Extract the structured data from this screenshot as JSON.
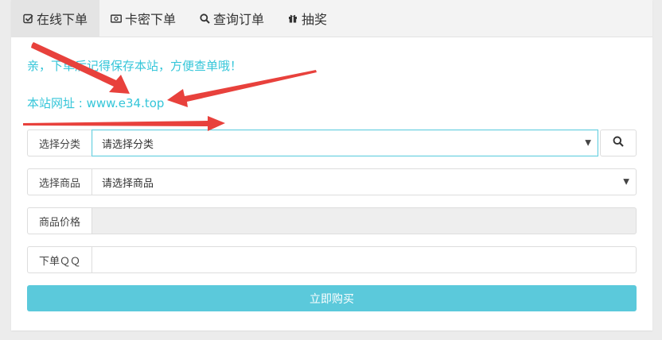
{
  "tabs": [
    {
      "label": "在线下单",
      "icon": "check-square-icon",
      "active": true
    },
    {
      "label": "卡密下单",
      "icon": "money-icon",
      "active": false
    },
    {
      "label": "查询订单",
      "icon": "search-icon",
      "active": false
    },
    {
      "label": "抽奖",
      "icon": "gift-icon",
      "active": false
    }
  ],
  "notice": {
    "line1": "亲，下单后记得保存本站，方便查单哦！",
    "line2": "本站网址 : www.e34.top"
  },
  "form": {
    "category": {
      "label": "选择分类",
      "value": "请选择分类"
    },
    "product": {
      "label": "选择商品",
      "value": "请选择商品"
    },
    "price": {
      "label": "商品价格",
      "value": ""
    },
    "qq": {
      "label": "下单ＱＱ",
      "value": ""
    }
  },
  "buy_button": "立即购买",
  "colors": {
    "accent": "#35c6d9",
    "button": "#5bc9db",
    "arrow": "#e8413c"
  }
}
